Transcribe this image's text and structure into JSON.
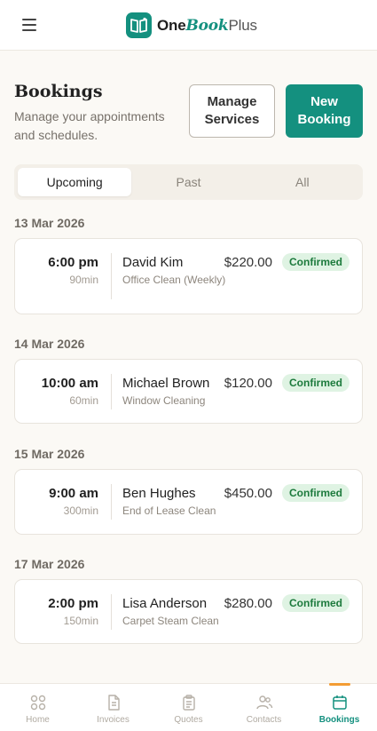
{
  "app": {
    "name_one": "One",
    "name_book": "Book",
    "name_plus": "Plus"
  },
  "header": {
    "title": "Bookings",
    "subtitle": "Manage your appointments and schedules.",
    "manage_services_label": "Manage Services",
    "new_booking_label": "New Booking"
  },
  "tabs": [
    {
      "label": "Upcoming",
      "active": true
    },
    {
      "label": "Past",
      "active": false
    },
    {
      "label": "All",
      "active": false
    }
  ],
  "groups": [
    {
      "date": "13 Mar 2026",
      "booking": {
        "time": "6:00 pm",
        "duration": "90min",
        "client": "David Kim",
        "service": "Office Clean (Weekly)",
        "price": "$220.00",
        "status": "Confirmed"
      }
    },
    {
      "date": "14 Mar 2026",
      "booking": {
        "time": "10:00 am",
        "duration": "60min",
        "client": "Michael Brown",
        "service": "Window Cleaning",
        "price": "$120.00",
        "status": "Confirmed"
      }
    },
    {
      "date": "15 Mar 2026",
      "booking": {
        "time": "9:00 am",
        "duration": "300min",
        "client": "Ben Hughes",
        "service": "End of Lease Clean",
        "price": "$450.00",
        "status": "Confirmed"
      }
    },
    {
      "date": "17 Mar 2026",
      "booking": {
        "time": "2:00 pm",
        "duration": "150min",
        "client": "Lisa Anderson",
        "service": "Carpet Steam Clean",
        "price": "$280.00",
        "status": "Confirmed"
      }
    }
  ],
  "bottom_nav": [
    {
      "label": "Home",
      "icon": "home-grid-icon",
      "active": false
    },
    {
      "label": "Invoices",
      "icon": "invoice-document-icon",
      "active": false
    },
    {
      "label": "Quotes",
      "icon": "quotes-clipboard-icon",
      "active": false
    },
    {
      "label": "Contacts",
      "icon": "contacts-people-icon",
      "active": false
    },
    {
      "label": "Bookings",
      "icon": "calendar-icon",
      "active": true
    }
  ],
  "colors": {
    "brand": "#14907f",
    "status_confirmed_bg": "#dff3e3",
    "status_confirmed_text": "#1c7a3c",
    "nav_indicator": "#f39c33"
  }
}
